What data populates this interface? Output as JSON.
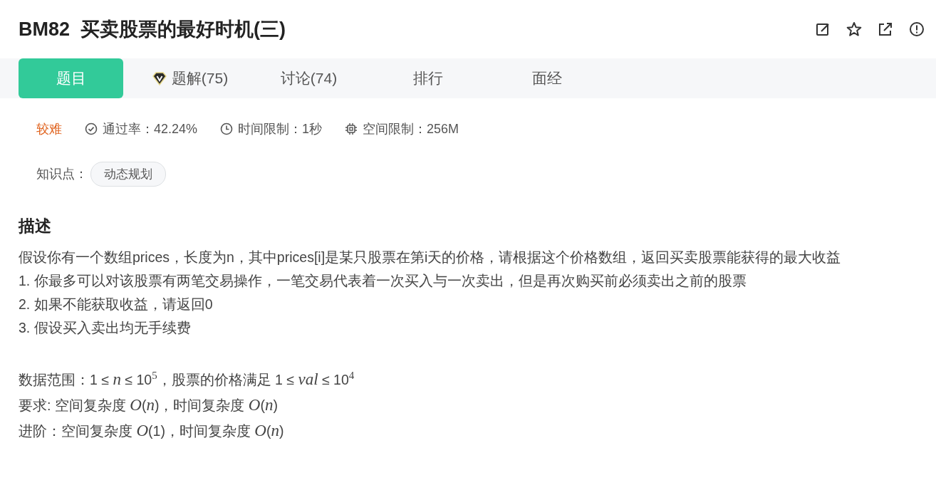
{
  "title": "BM82  买卖股票的最好时机(三)",
  "toolbar": [
    {
      "kind": "edit"
    },
    {
      "kind": "star"
    },
    {
      "kind": "share"
    },
    {
      "kind": "report"
    }
  ],
  "tabs": [
    {
      "label": "题目",
      "selected": true,
      "badge": false
    },
    {
      "label": "题解(75)",
      "selected": false,
      "badge": true
    },
    {
      "label": "讨论(74)",
      "selected": false,
      "badge": false
    },
    {
      "label": "排行",
      "selected": false,
      "badge": false
    },
    {
      "label": "面经",
      "selected": false,
      "badge": false
    }
  ],
  "meta": {
    "difficulty": "较难",
    "stats": [
      {
        "kind": "pass",
        "text": "通过率：42.24%"
      },
      {
        "kind": "time",
        "text": "时间限制：1秒"
      },
      {
        "kind": "memory",
        "text": "空间限制：256M"
      }
    ]
  },
  "knowledge": {
    "label": "知识点：",
    "tags": [
      "动态规划"
    ]
  },
  "description": {
    "heading": "描述",
    "lines": [
      "假设你有一个数组prices，长度为n，其中prices[i]是某只股票在第i天的价格，请根据这个价格数组，返回买卖股票能获得的最大收益",
      "1. 你最多可以对该股票有两笔交易操作，一笔交易代表着一次买入与一次卖出，但是再次购买前必须卖出之前的股票",
      "2. 如果不能获取收益，请返回0",
      "3. 假设买入卖出均无手续费"
    ],
    "notes": [
      "数据范围：1 ≤ *n* ≤ 10$^{5}$，股票的价格满足 1 ≤ *val* ≤ 10$^{4}$",
      "要求: 空间复杂度 *O*(*n*)，时间复杂度 *O*(*n*)",
      "进阶：空间复杂度 *O*(1)，时间复杂度 *O*(*n*)"
    ]
  }
}
